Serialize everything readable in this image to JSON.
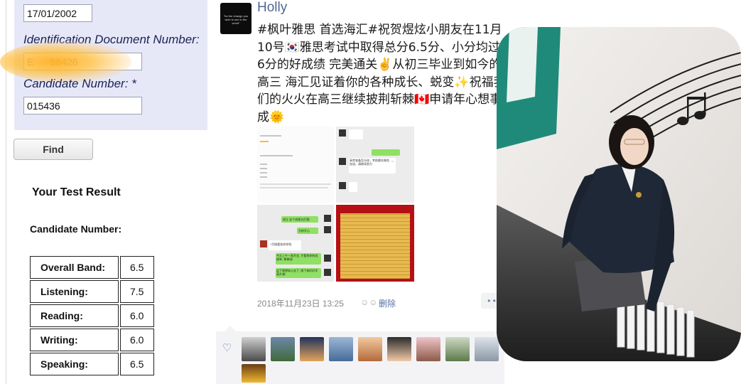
{
  "result_form": {
    "dob_value": "17/01/2002",
    "id_label": "Identification Document Number:",
    "id_value": "E      58426",
    "candidate_label": "Candidate Number: *",
    "candidate_value": "015436",
    "find_label": "Find",
    "result_heading": "Your Test Result",
    "candidate_number_label": "Candidate Number:",
    "scores": [
      {
        "label": "Overall Band:",
        "value": "6.5"
      },
      {
        "label": "Listening:",
        "value": "7.5"
      },
      {
        "label": "Reading:",
        "value": "6.0"
      },
      {
        "label": "Writing:",
        "value": "6.0"
      },
      {
        "label": "Speaking:",
        "value": "6.5"
      }
    ]
  },
  "post": {
    "user_name": "Holly",
    "avatar_text": "\"be the change you wish to see in the world\"",
    "text": "#枫叶雅思 首选海汇#祝贺煜炫小朋友在11月10号🇰🇷雅思考试中取得总分6.5分、小分均过6分的好成绩 完美通关✌️从初三毕业到如今的高三 海汇见证着你的各种成长、蜕变✨祝福我们的火火在高三继续披荆斩棘🇨🇦申请年心想事成🌞",
    "timestamp": "2018年11月23日 13:25",
    "delete_label": "删除",
    "more_label": "• •",
    "chat_bubble_1": "高考准备怎么样，考前都在做些…，加油，请继续努力",
    "chat_bubble_2": "成立 这个成绩太厉害!",
    "chat_bubble_3": "为你开心",
    "chat_bubble_4": "7月刚要准你你啦",
    "chat_bubble_5": "今天上午一直开会, 才看到你的成绩单, 棒棒哒!",
    "chat_bubble_6": "这下我想安心去了, 接下来好好学高升课!"
  },
  "colors": {
    "form_bg": "#e6e8f7",
    "label_navy": "#1b2155",
    "link_blue": "#4f6794",
    "red_poster": "#b51016"
  }
}
